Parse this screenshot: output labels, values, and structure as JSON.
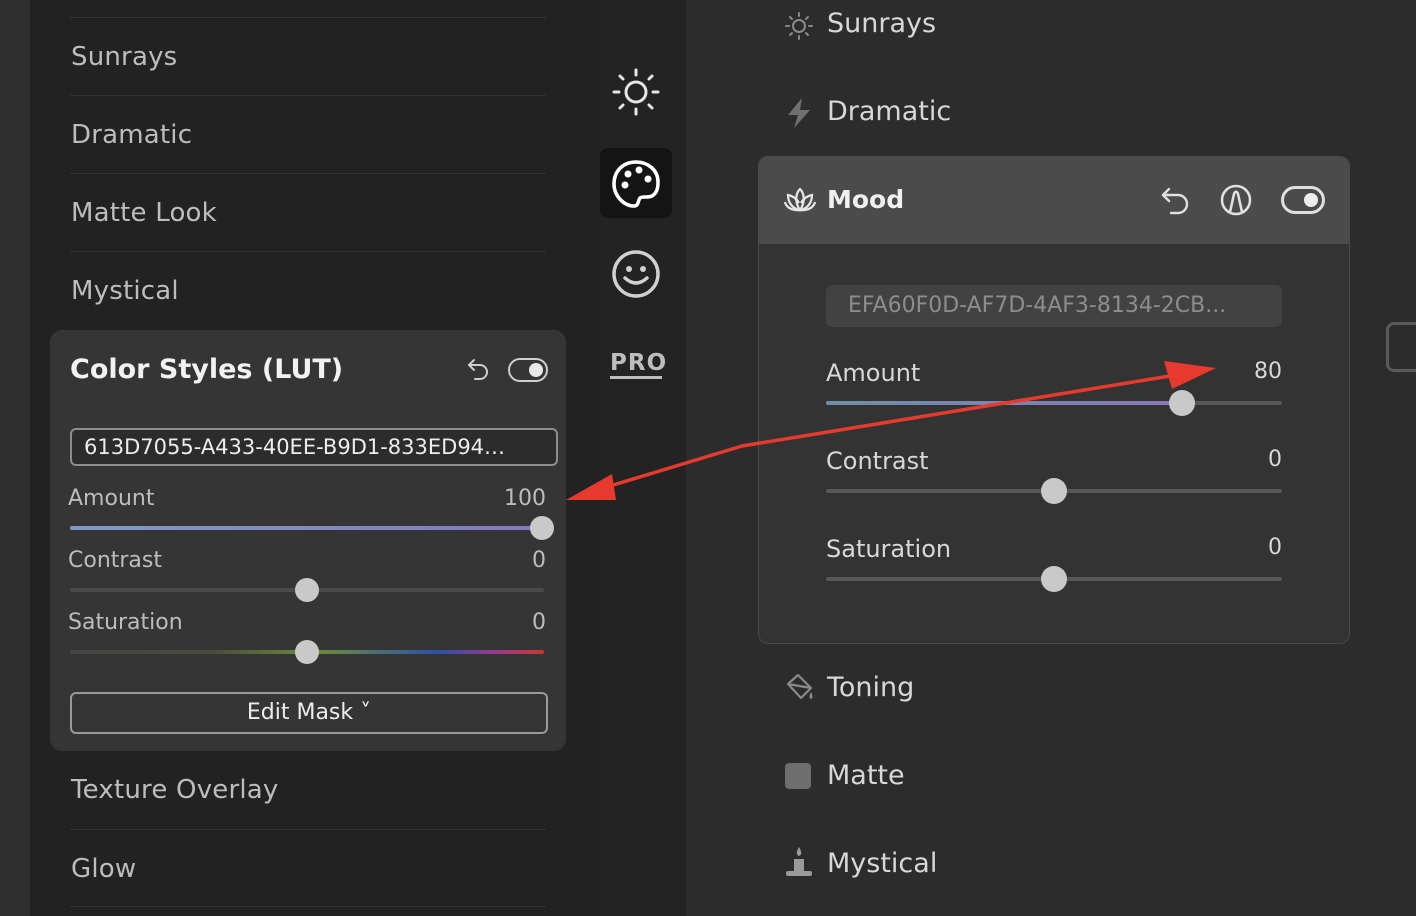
{
  "left_list": {
    "items_top": [
      "Sunrays",
      "Dramatic",
      "Matte Look",
      "Mystical"
    ],
    "items_bottom": [
      "Texture Overlay",
      "Glow"
    ]
  },
  "color_styles_card": {
    "title": "Color Styles (LUT)",
    "lut_id": "613D7055-A433-40EE-B9D1-833ED94…",
    "sliders": [
      {
        "label": "Amount",
        "value": "100",
        "fraction": 1.0
      },
      {
        "label": "Contrast",
        "value": "0",
        "fraction": 0.5
      },
      {
        "label": "Saturation",
        "value": "0",
        "fraction": 0.5
      }
    ],
    "edit_mask_label": "Edit Mask ˅"
  },
  "icon_column": {
    "icons": [
      "sun-icon",
      "palette-icon",
      "smiley-icon",
      "pro-icon"
    ],
    "pro_text": "PRO",
    "selected": "palette-icon"
  },
  "right_list": {
    "items_top": [
      {
        "label": "Sunrays",
        "icon": "sun-icon"
      },
      {
        "label": "Dramatic",
        "icon": "lightning-icon"
      }
    ],
    "items_bottom": [
      {
        "label": "Toning",
        "icon": "paint-bucket-icon"
      },
      {
        "label": "Matte",
        "icon": "square-icon"
      },
      {
        "label": "Mystical",
        "icon": "candle-icon"
      }
    ]
  },
  "mood_card": {
    "title": "Mood",
    "lut_id": "EFA60F0D-AF7D-4AF3-8134-2CB...",
    "sliders": [
      {
        "label": "Amount",
        "value": "80",
        "fraction": 0.8
      },
      {
        "label": "Contrast",
        "value": "0",
        "fraction": 0.5
      },
      {
        "label": "Saturation",
        "value": "0",
        "fraction": 0.5
      }
    ]
  },
  "colors": {
    "annotation_arrow": "#e53a2d",
    "amount_fill": "#8088c4"
  }
}
